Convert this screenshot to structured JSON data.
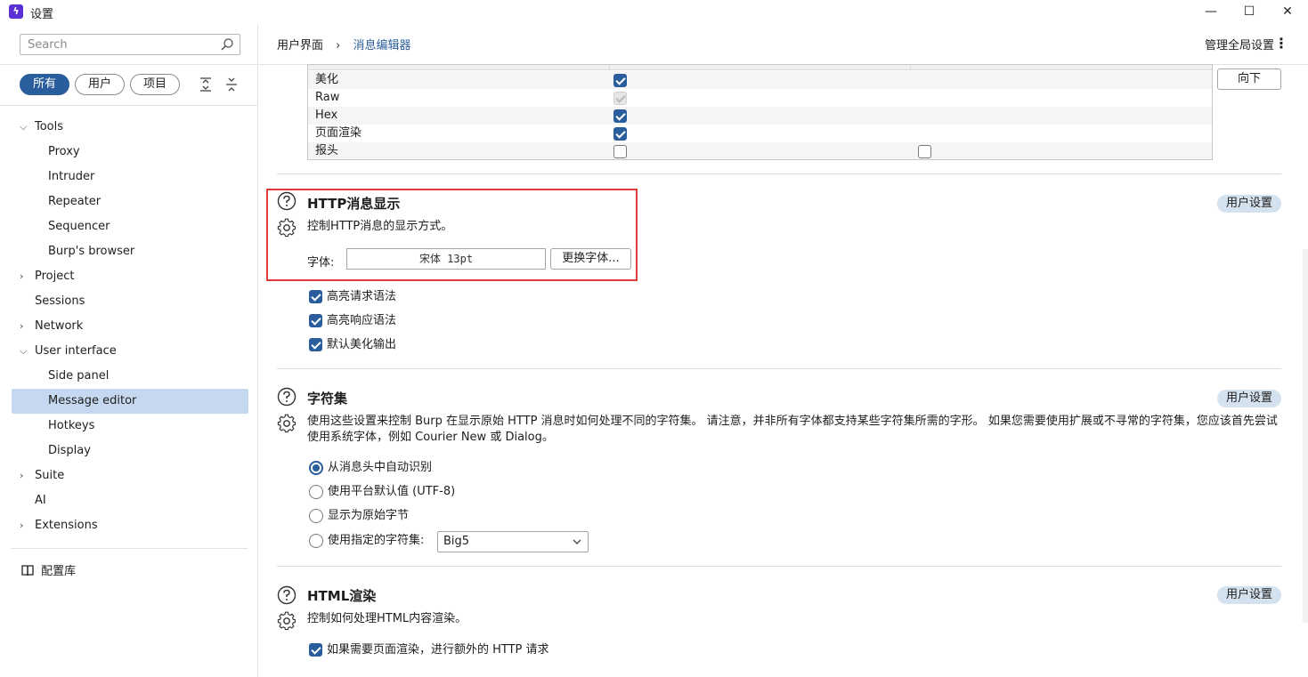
{
  "window": {
    "title": "设置",
    "minimize": "—",
    "maximize": "☐",
    "close": "✕"
  },
  "sidebar": {
    "search_placeholder": "Search",
    "filters": [
      "所有",
      "用户",
      "项目"
    ],
    "tree": [
      {
        "label": "Tools",
        "expanded": true
      },
      {
        "label": "Proxy"
      },
      {
        "label": "Intruder"
      },
      {
        "label": "Repeater"
      },
      {
        "label": "Sequencer"
      },
      {
        "label": "Burp's browser"
      },
      {
        "label": "Project",
        "expanded": false
      },
      {
        "label": "Sessions"
      },
      {
        "label": "Network",
        "expanded": false
      },
      {
        "label": "User interface",
        "expanded": true
      },
      {
        "label": "Side panel"
      },
      {
        "label": "Message editor",
        "selected": true
      },
      {
        "label": "Hotkeys"
      },
      {
        "label": "Display"
      },
      {
        "label": "Suite",
        "expanded": false
      },
      {
        "label": "AI"
      },
      {
        "label": "Extensions",
        "expanded": false
      }
    ],
    "config_library": "配置库"
  },
  "header": {
    "breadcrumb": [
      "用户界面",
      "消息编辑器"
    ],
    "global_settings": "管理全局设置"
  },
  "table": {
    "rows": [
      {
        "label": "美化",
        "col1": "checked",
        "col2": null
      },
      {
        "label": "Raw",
        "col1": "disabled-checked",
        "col2": null
      },
      {
        "label": "Hex",
        "col1": "checked",
        "col2": null
      },
      {
        "label": "页面渲染",
        "col1": "checked",
        "col2": null
      },
      {
        "label": "报头",
        "col1": "unchecked",
        "col2": "unchecked"
      }
    ],
    "down_button": "向下"
  },
  "http_display": {
    "title": "HTTP消息显示",
    "description": "控制HTTP消息的显示方式。",
    "font_label": "字体:",
    "font_value": "宋体 13pt",
    "change_font_button": "更换字体...",
    "badge": "用户设置",
    "options": [
      {
        "label": "高亮请求语法",
        "checked": true
      },
      {
        "label": "高亮响应语法",
        "checked": true
      },
      {
        "label": "默认美化输出",
        "checked": true
      }
    ]
  },
  "charset": {
    "title": "字符集",
    "description_line1": "使用这些设置来控制 Burp 在显示原始 HTTP 消息时如何处理不同的字符集。 请注意，并非所有字体都支持某些字符集所需的字形。 如果您需要使用扩展或不寻常的字符集，您应该首先尝试",
    "description_line2": "使用系统字体，例如 Courier New 或 Dialog。",
    "badge": "用户设置",
    "options": [
      {
        "label": "从消息头中自动识别",
        "checked": true
      },
      {
        "label": "使用平台默认值 (UTF-8)",
        "checked": false
      },
      {
        "label": "显示为原始字节",
        "checked": false
      },
      {
        "label": "使用指定的字符集:",
        "checked": false
      }
    ],
    "charset_select": "Big5"
  },
  "html_render": {
    "title": "HTML渲染",
    "description": "控制如何处理HTML内容渲染。",
    "badge": "用户设置",
    "options": [
      {
        "label": "如果需要页面渲染，进行额外的 HTTP 请求",
        "checked": true
      }
    ]
  },
  "colors": {
    "accent": "#2a5d9c",
    "selected_bg": "#c6d8ef",
    "badge_bg": "#d4e1ef",
    "highlight_border": "#e03b3b"
  }
}
